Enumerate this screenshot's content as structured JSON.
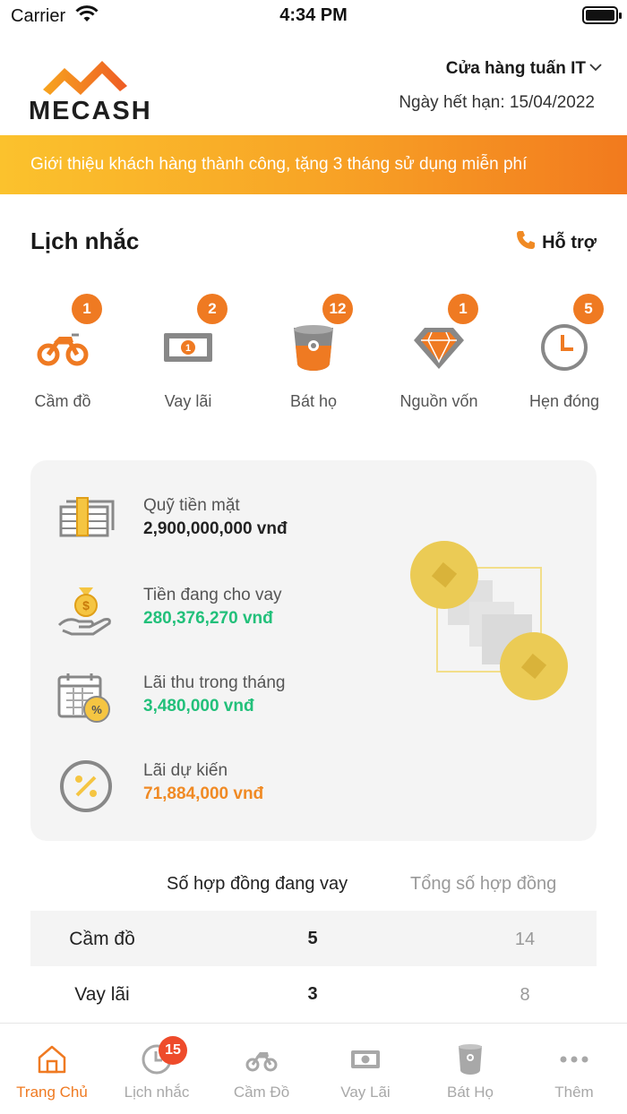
{
  "status_bar": {
    "carrier": "Carrier",
    "time": "4:34 PM"
  },
  "header": {
    "logo_text": "MECASH",
    "store_name": "Cửa hàng tuấn IT",
    "expiry": "Ngày hết hạn: 15/04/2022"
  },
  "banner": {
    "text": "Giới thiệu khách hàng thành công, tặng 3 tháng sử dụng miễn phí"
  },
  "reminders": {
    "title": "Lịch nhắc",
    "support_label": "Hỗ trợ",
    "items": [
      {
        "label": "Cầm đồ",
        "count": "1",
        "icon": "motorbike-icon"
      },
      {
        "label": "Vay lãi",
        "count": "2",
        "icon": "banknote-icon"
      },
      {
        "label": "Bát họ",
        "count": "12",
        "icon": "bowl-icon"
      },
      {
        "label": "Nguồn vốn",
        "count": "1",
        "icon": "diamond-icon"
      },
      {
        "label": "Hẹn đóng",
        "count": "5",
        "icon": "clock-icon"
      }
    ]
  },
  "summary": {
    "items": [
      {
        "title": "Quỹ tiền mặt",
        "value": "2,900,000,000 vnđ",
        "icon": "cash-stack-icon"
      },
      {
        "title": "Tiền đang cho vay",
        "value": "280,376,270 vnđ",
        "icon": "money-bag-hand-icon"
      },
      {
        "title": "Lãi thu trong tháng",
        "value": "3,480,000 vnđ",
        "icon": "calendar-percent-icon"
      },
      {
        "title": "Lãi dự kiến",
        "value": "71,884,000 vnđ",
        "icon": "percent-circle-icon"
      }
    ],
    "colors": {
      "green": "#22c07a",
      "orange": "#f08a24"
    }
  },
  "contracts": {
    "headers": [
      "Số hợp đồng đang vay",
      "Tổng số hợp đồng"
    ],
    "rows": [
      {
        "name": "Cầm đồ",
        "active": "5",
        "total": "14"
      },
      {
        "name": "Vay lãi",
        "active": "3",
        "total": "8"
      }
    ]
  },
  "tabbar": {
    "tabs": [
      {
        "label": "Trang Chủ",
        "icon": "home-icon",
        "active": true
      },
      {
        "label": "Lịch nhắc",
        "icon": "clock-icon",
        "badge": "15"
      },
      {
        "label": "Cầm Đồ",
        "icon": "motorbike-icon"
      },
      {
        "label": "Vay Lãi",
        "icon": "banknote-icon"
      },
      {
        "label": "Bát Họ",
        "icon": "bowl-icon"
      },
      {
        "label": "Thêm",
        "icon": "more-icon"
      }
    ]
  },
  "accent_color": "#ef7a22"
}
